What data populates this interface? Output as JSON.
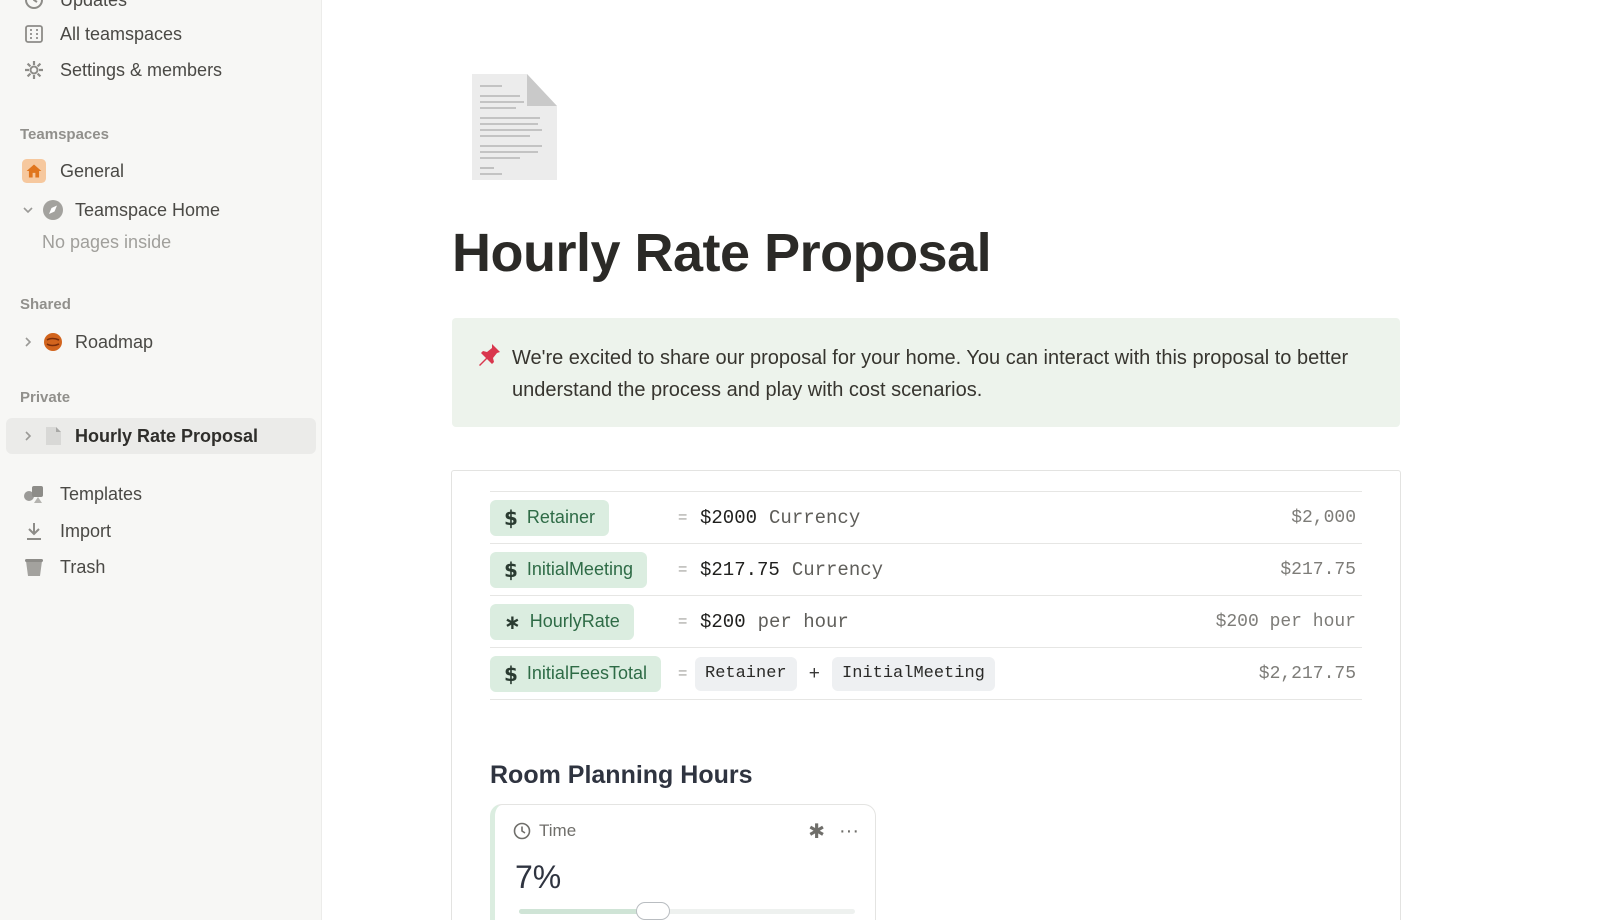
{
  "sidebar": {
    "top_items": [
      {
        "label": "Updates",
        "icon": "clock-icon"
      },
      {
        "label": "All teamspaces",
        "icon": "building-icon"
      },
      {
        "label": "Settings & members",
        "icon": "gear-icon"
      }
    ],
    "teamspaces_heading": "Teamspaces",
    "general_label": "General",
    "teamspace_home_label": "Teamspace Home",
    "no_pages_label": "No pages inside",
    "shared_heading": "Shared",
    "roadmap_label": "Roadmap",
    "private_heading": "Private",
    "active_page_label": "Hourly Rate Proposal",
    "bottom_items": [
      {
        "label": "Templates",
        "icon": "templates-icon"
      },
      {
        "label": "Import",
        "icon": "import-icon"
      },
      {
        "label": "Trash",
        "icon": "trash-icon"
      }
    ]
  },
  "page": {
    "title": "Hourly Rate Proposal",
    "callout_text": "We're excited to share our proposal for your home. You can interact with this proposal to better understand the process and play with cost scenarios."
  },
  "variables": [
    {
      "name": "Retainer",
      "symbol": "$",
      "equals": "=",
      "value": "$2000",
      "unit": "Currency",
      "result": "$2,000"
    },
    {
      "name": "InitialMeeting",
      "symbol": "$",
      "equals": "=",
      "value": "$217.75",
      "unit": "Currency",
      "result": "$217.75"
    },
    {
      "name": "HourlyRate",
      "symbol": "∗",
      "equals": "=",
      "value": "$200",
      "unit": "per hour",
      "result": "$200 per hour"
    },
    {
      "name": "InitialFeesTotal",
      "symbol": "$",
      "equals": "=",
      "ref1": "Retainer",
      "op": "+",
      "ref2": "InitialMeeting",
      "result": "$2,217.75"
    }
  ],
  "room_planning": {
    "heading": "Room Planning Hours",
    "slider_label": "Time",
    "slider_value_text": "7%",
    "slider_fraction": 0.4
  },
  "colors": {
    "sidebar_bg": "#f7f7f5",
    "callout_bg": "#edf3ec",
    "chip_bg": "#dbede0",
    "chip_text": "#2e6b46",
    "general_icon_bg": "#f6c89e",
    "general_icon": "#e0751d"
  }
}
